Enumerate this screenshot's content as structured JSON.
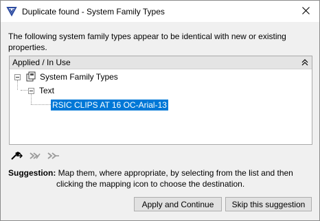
{
  "window": {
    "title": "Duplicate found - System Family Types",
    "close_glyph": "✕"
  },
  "description": "The following system family types appear to be identical with new or existing properties.",
  "tree": {
    "header_label": "Applied / In Use",
    "collapse_all_glyph": "»",
    "nodes": [
      {
        "label": "System Family Types",
        "icon": "family-folder-icon",
        "expanded": true
      },
      {
        "label": "Text",
        "expanded": true
      },
      {
        "label": "RSIC CLIPS AT 16 OC-Arial-13",
        "selected": true
      }
    ]
  },
  "toolbar": {
    "icons": [
      "map-selected-icon",
      "map-forward-icon",
      "map-skip-icon"
    ]
  },
  "suggestion": {
    "label": "Suggestion:",
    "line1": "Map them, where appropriate, by selecting from the list and then",
    "line2": "clicking the mapping icon to choose the destination."
  },
  "buttons": {
    "apply": "Apply and Continue",
    "skip": "Skip this suggestion"
  },
  "colors": {
    "selection": "#0078d7",
    "accent_icon": "#2b4aa0"
  }
}
